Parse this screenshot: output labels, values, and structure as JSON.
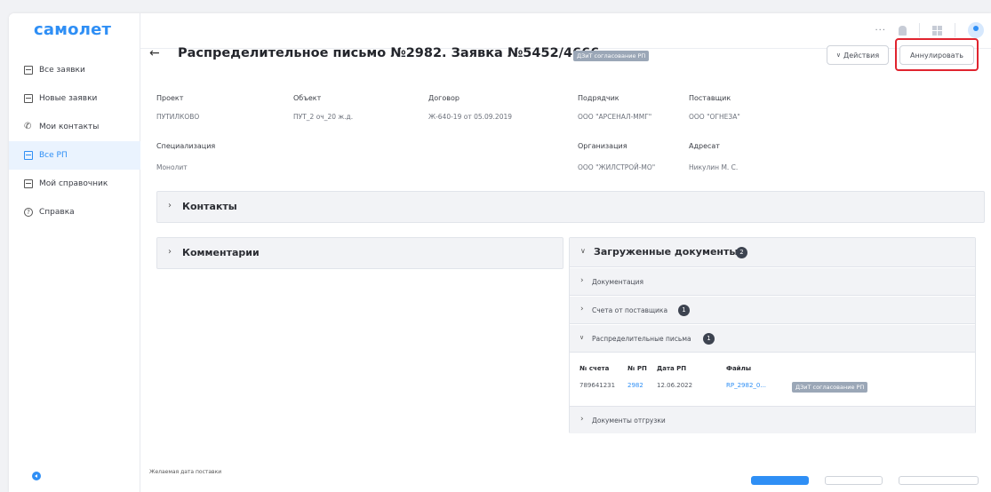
{
  "app": {
    "logo": "самолет"
  },
  "sidebar": {
    "items": [
      {
        "label": "Все заявки",
        "icon": "document-icon"
      },
      {
        "label": "Новые заявки",
        "icon": "document-icon"
      },
      {
        "label": "Мои контакты",
        "icon": "phone-icon"
      },
      {
        "label": "Все РП",
        "icon": "document-icon",
        "active": true
      },
      {
        "label": "Мой справочник",
        "icon": "document-icon"
      },
      {
        "label": "Справка",
        "icon": "help-icon"
      }
    ]
  },
  "topbar": {
    "more": "···"
  },
  "header": {
    "title": "Распределительное письмо №2982. Заявка №5452/4666",
    "status_badge": "ДЗиТ согласование РП",
    "actions_label": "Действия",
    "cancel_label": "Аннулировать"
  },
  "info": {
    "project": {
      "label": "Проект",
      "value": "ПУТИЛКОВО"
    },
    "object": {
      "label": "Объект",
      "value": "ПУТ_2 оч_20 ж.д."
    },
    "contract": {
      "label": "Договор",
      "value": "Ж-640-19 от 05.09.2019"
    },
    "contractor": {
      "label": "Подрядчик",
      "value": "ООО \"АРСЕНАЛ-ММГ\""
    },
    "supplier": {
      "label": "Поставщик",
      "value": "ООО \"ОГНЕЗА\""
    },
    "specialization": {
      "label": "Специализация",
      "value": "Монолит"
    },
    "organization": {
      "label": "Организация",
      "value": "ООО \"ЖИЛСТРОЙ-МО\""
    },
    "addressee": {
      "label": "Адресат",
      "value": "Никулин М. С."
    }
  },
  "contacts": {
    "title": "Контакты"
  },
  "comments": {
    "title": "Комментарии"
  },
  "documents": {
    "title": "Загруженные документы",
    "count": "2",
    "sections": {
      "documentation": {
        "label": "Документация"
      },
      "invoices": {
        "label": "Счета от поставщика",
        "count": "1"
      },
      "letters": {
        "label": "Распределительные письма",
        "count": "1"
      },
      "shipping": {
        "label": "Документы отгрузки"
      }
    },
    "table": {
      "headers": [
        "№ счета",
        "№ РП",
        "Дата РП",
        "Файлы"
      ],
      "row": {
        "invoice": "789641231",
        "rp": "2982",
        "date": "12.06.2022",
        "file": "RP_2982_0...",
        "status": "ДЗиТ согласование РП"
      }
    }
  },
  "footer": {
    "delivery_label": "Желаемая дата поставки"
  }
}
